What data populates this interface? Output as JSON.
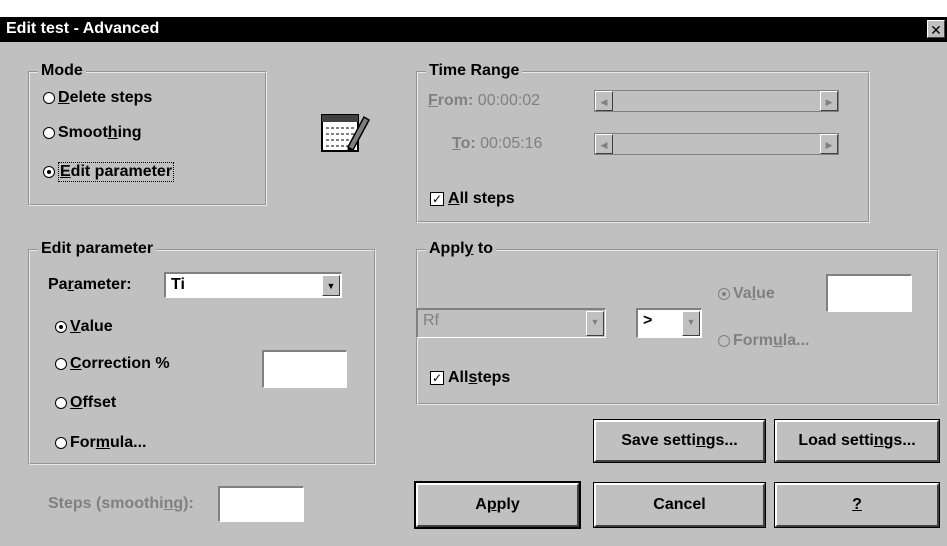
{
  "window": {
    "title": "Edit test - Advanced",
    "close_glyph": "✕"
  },
  "mode": {
    "title": "Mode",
    "options": [
      {
        "prefix": "",
        "accel": "D",
        "rest": "elete steps",
        "selected": false
      },
      {
        "prefix": "Smoot",
        "accel": "h",
        "rest": "ing",
        "selected": false
      },
      {
        "prefix": "",
        "accel": "E",
        "rest": "dit parameter",
        "selected": true
      }
    ],
    "icon": "edit-notepad-pencil-icon"
  },
  "time_range": {
    "title": "Time Range",
    "from_accel": "F",
    "from_rest": "rom:",
    "from_value": "00:00:02",
    "to_accel": "T",
    "to_rest": "o:",
    "to_value": "00:05:16",
    "all_steps_accel": "A",
    "all_steps_rest": "ll steps",
    "all_steps_checked": true
  },
  "edit_parameter": {
    "title": "Edit parameter",
    "param_label_pre": "Pa",
    "param_label_accel": "r",
    "param_label_post": "ameter:",
    "param_value": "Ti",
    "options": [
      {
        "prefix": "",
        "accel": "V",
        "rest": "alue",
        "selected": true
      },
      {
        "prefix": "",
        "accel": "C",
        "rest": "orrection %",
        "selected": false
      },
      {
        "prefix": "",
        "accel": "O",
        "rest": "ffset",
        "selected": false
      },
      {
        "prefix": "For",
        "accel": "m",
        "rest": "ula...",
        "selected": false
      }
    ],
    "correction_value": ""
  },
  "steps_smoothing": {
    "label_pre": "Steps (smoothi",
    "label_accel": "n",
    "label_post": "g):",
    "value": ""
  },
  "apply_to": {
    "title_pre": "Appl",
    "title_accel": "y",
    "title_post": " to",
    "param_value": "Rf",
    "operator_value": ">",
    "value_label_pre": "Va",
    "value_label_accel": "l",
    "value_label_post": "ue",
    "formula_label_pre": "Form",
    "formula_label_accel": "u",
    "formula_label_post": "la...",
    "value_selected": true,
    "value_field": "",
    "all_steps_pre": "All ",
    "all_steps_accel": "s",
    "all_steps_post": "teps",
    "all_steps_checked": true
  },
  "buttons": {
    "save_pre": "Save setti",
    "save_accel": "n",
    "save_post": "gs...",
    "load_pre": "Load setti",
    "load_accel": "n",
    "load_post": "gs...",
    "apply_pre": "A",
    "apply_accel": "p",
    "apply_post": "ply",
    "cancel": "Cancel",
    "help": "?"
  }
}
